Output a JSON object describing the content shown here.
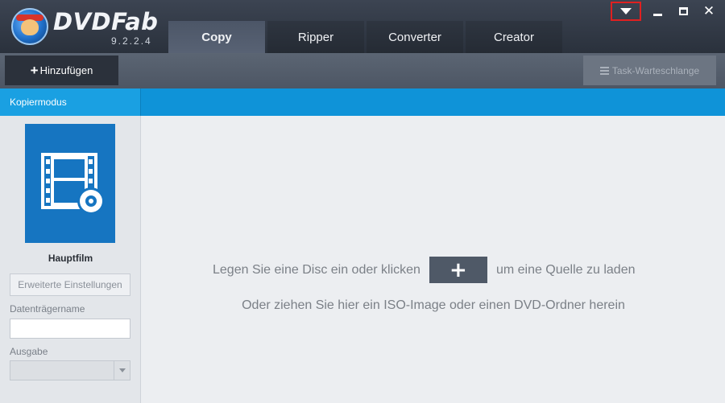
{
  "app": {
    "name": "DVDFab",
    "version": "9.2.2.4"
  },
  "tabs": [
    {
      "label": "Copy",
      "active": true
    },
    {
      "label": "Ripper",
      "active": false
    },
    {
      "label": "Converter",
      "active": false
    },
    {
      "label": "Creator",
      "active": false
    }
  ],
  "window_controls": {
    "menu_icon": "dropdown-triangle-icon",
    "min_icon": "minimize-icon",
    "max_icon": "maximize-icon",
    "close_icon": "close-icon",
    "close_glyph": "✕"
  },
  "toolbar": {
    "add_label": "Hinzufügen",
    "add_glyph": "+",
    "queue_label": "Task-Warteschlange"
  },
  "sidebar": {
    "section_title": "Kopiermodus",
    "mode_label": "Hauptfilm",
    "advanced_button": "Erweiterte Einstellungen",
    "volume_label": "Datenträgername",
    "volume_value": "",
    "output_label": "Ausgabe",
    "output_value": ""
  },
  "main": {
    "line1_before": "Legen Sie eine Disc ein oder klicken",
    "line1_after": "um eine Quelle zu laden",
    "add_source_glyph": "+",
    "line2": "Oder ziehen Sie hier ein ISO-Image oder einen DVD-Ordner herein"
  },
  "colors": {
    "accent_blue": "#0f93d8",
    "tile_blue": "#1675c1",
    "titlebar": "#2f3641",
    "highlight_red": "#e02020"
  }
}
